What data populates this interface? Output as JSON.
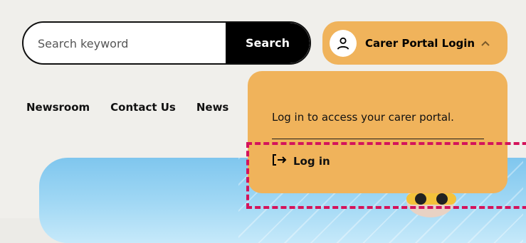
{
  "search": {
    "placeholder": "Search keyword",
    "button_label": "Search"
  },
  "portal": {
    "button_label": "Carer Portal Login"
  },
  "nav": {
    "items": [
      "Newsroom",
      "Contact Us",
      "News"
    ]
  },
  "dropdown": {
    "message": "Log in to access your carer portal.",
    "login_label": "Log in"
  },
  "colors": {
    "accent": "#f0b35b",
    "highlight": "#d4135b"
  }
}
